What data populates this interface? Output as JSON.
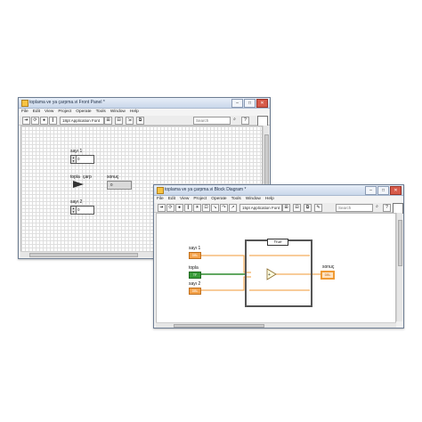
{
  "front_panel": {
    "title": "toplama ve ya çarpma.vi Front Panel *",
    "menu": [
      "File",
      "Edit",
      "View",
      "Project",
      "Operate",
      "Tools",
      "Window",
      "Help"
    ],
    "toolbar": {
      "font_select": "18pt Application Font",
      "search_placeholder": "Search"
    },
    "controls": {
      "sayi1_label": "sayı 1",
      "sayi1_value": "0",
      "toggle_label_left": "topla",
      "toggle_label_right": "çarp",
      "sayi2_label": "sayı 2",
      "sayi2_value": "0",
      "sonuc_label": "sonuç",
      "sonuc_value": "0"
    }
  },
  "block_diagram": {
    "title": "toplama ve ya çarpma.vi Block Diagram *",
    "menu": [
      "File",
      "Edit",
      "View",
      "Project",
      "Operate",
      "Tools",
      "Window",
      "Help"
    ],
    "toolbar": {
      "font_select": "15pt Application Font",
      "search_placeholder": "Search"
    },
    "nodes": {
      "sayi1_label": "sayı 1",
      "sayi1_term": "DBL",
      "topla_label": "topla",
      "topla_term": "TF",
      "sayi2_label": "sayı 2",
      "sayi2_term": "DBL",
      "case_selector": "True",
      "sonuc_label": "sonuç",
      "sonuc_term": "DBL"
    },
    "colors": {
      "numeric_wire": "#f09a34",
      "boolean_wire": "#2e8b2e"
    }
  }
}
